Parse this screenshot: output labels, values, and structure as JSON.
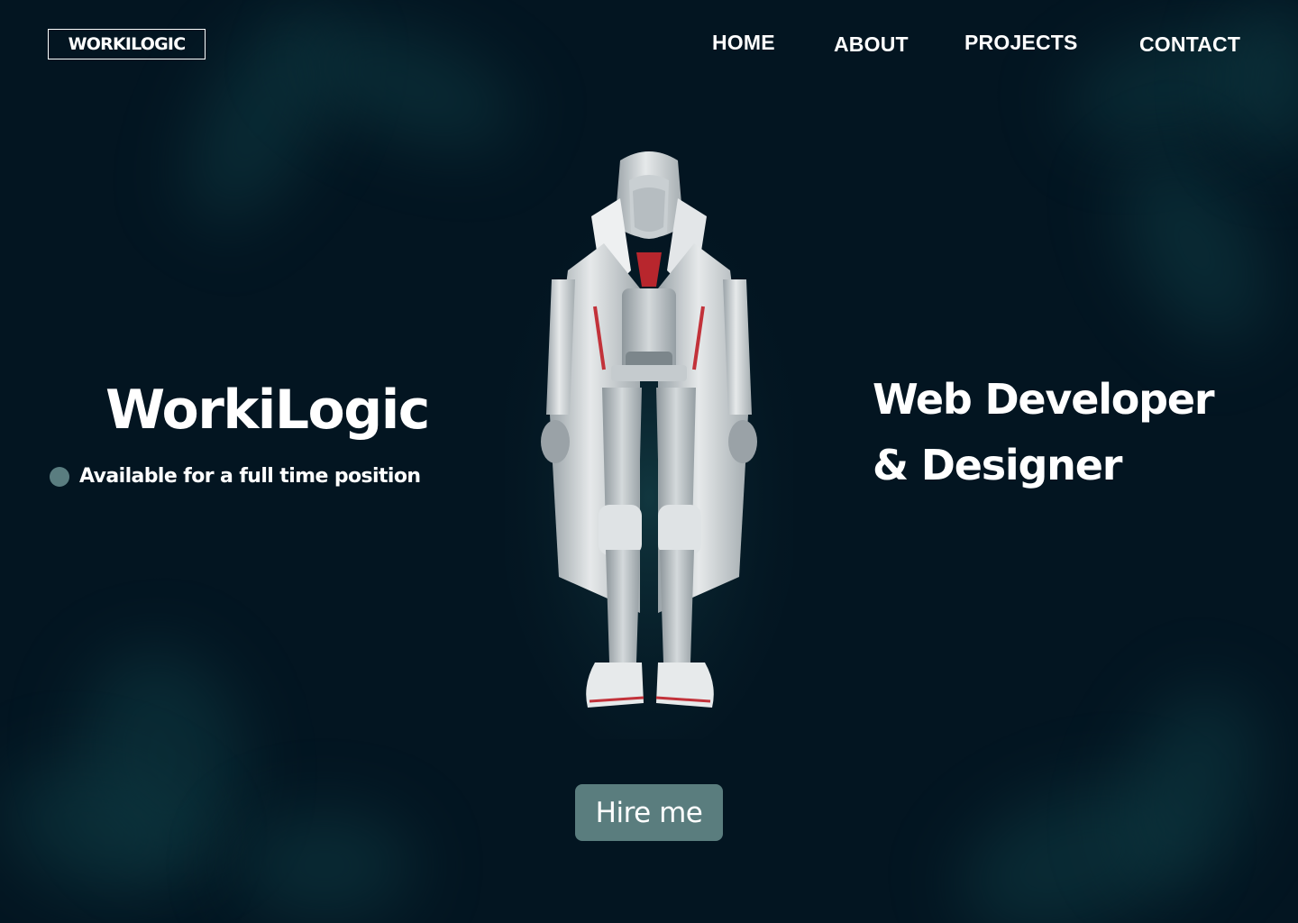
{
  "brand": {
    "logo_text": "WORKILOGIC"
  },
  "nav": {
    "items": [
      {
        "label": "HOME"
      },
      {
        "label": "ABOUT"
      },
      {
        "label": "PROJECTS"
      },
      {
        "label": "CONTACT"
      }
    ]
  },
  "hero": {
    "name": "WorkiLogic",
    "status_text": "Available for a full time position",
    "role_line_1": "Web Developer",
    "role_line_2": "& Designer",
    "figure_image": "hooded-robot-figure"
  },
  "cta": {
    "hire_label": "Hire me"
  },
  "colors": {
    "background": "#031521",
    "accent": "#5a7d7e",
    "text": "#ffffff",
    "blob": "#0f3c44"
  }
}
